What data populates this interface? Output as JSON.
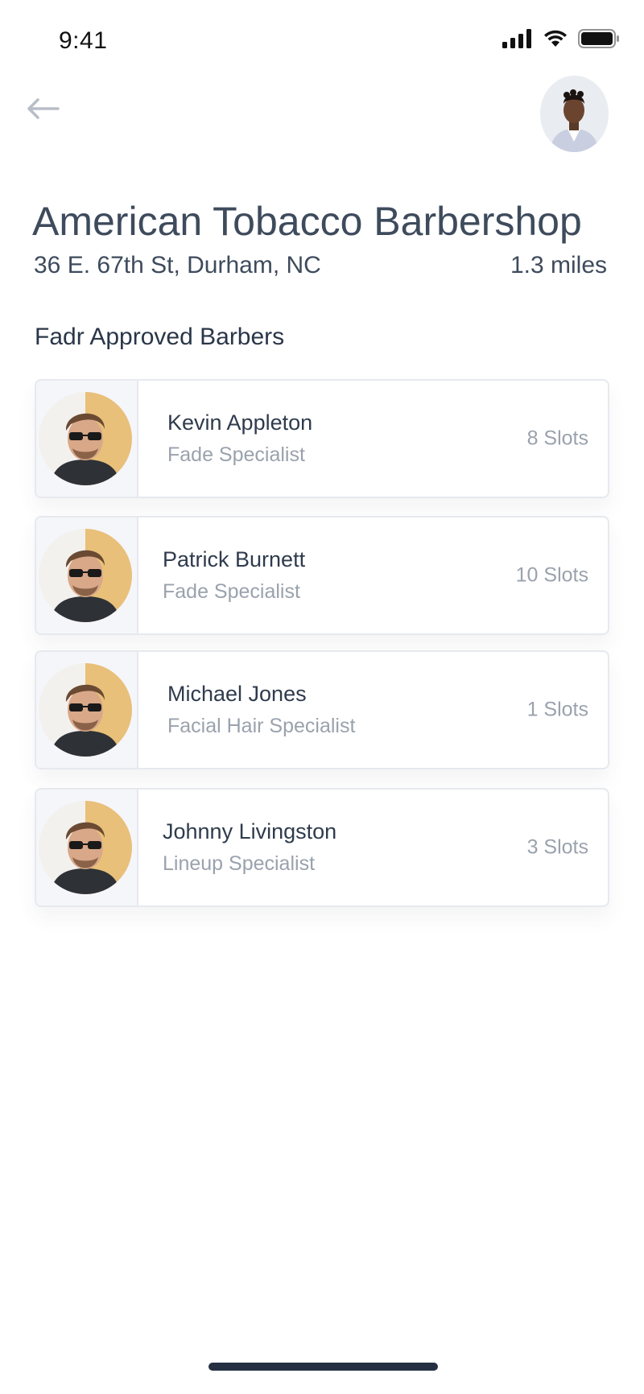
{
  "status_bar": {
    "time": "9:41"
  },
  "header": {
    "back_icon": "arrow-left-icon",
    "profile_icon": "avatar"
  },
  "shop": {
    "name": "American Tobacco Barbershop",
    "address": "36 E. 67th St, Durham, NC",
    "distance": "1.3 miles"
  },
  "section": {
    "title": "Fadr Approved Barbers"
  },
  "barbers": [
    {
      "name": "Kevin Appleton",
      "specialty": "Fade Specialist",
      "slots": "8 Slots"
    },
    {
      "name": "Patrick Burnett",
      "specialty": "Fade Specialist",
      "slots": "10 Slots"
    },
    {
      "name": "Michael Jones",
      "specialty": "Facial Hair Specialist",
      "slots": "1 Slots"
    },
    {
      "name": "Johnny Livingston",
      "specialty": "Lineup Specialist",
      "slots": "3 Slots"
    }
  ],
  "colors": {
    "text_primary": "#3e4b5c",
    "text_secondary": "#9aa2ad",
    "border": "#e6e9ee"
  }
}
